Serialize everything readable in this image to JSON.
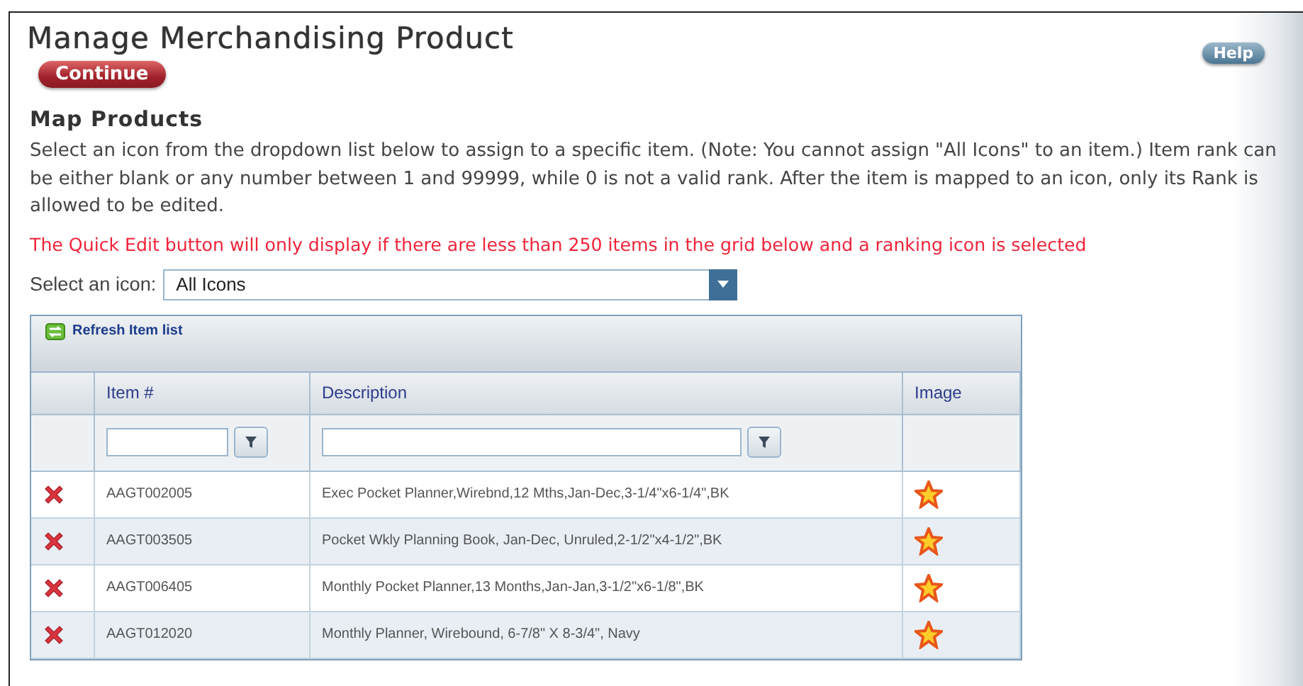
{
  "page": {
    "title": "Manage Merchandising Product"
  },
  "buttons": {
    "continue": "Continue",
    "help": "Help"
  },
  "section": {
    "heading": "Map Products",
    "instructions": "Select an icon from the dropdown list below to assign to a specific item. (Note: You cannot assign \"All Icons\" to an item.) Item rank can be either blank or any number between 1 and 99999, while 0 is not a valid rank. After the item is mapped to an icon, only its Rank is allowed to be edited.",
    "warning": "The Quick Edit button will only display if there are less than 250 items in the grid below and a ranking icon is selected"
  },
  "icon_select": {
    "label": "Select an icon:",
    "value": "All Icons"
  },
  "grid": {
    "toolbar": {
      "refresh": "Refresh Item list"
    },
    "columns": [
      "Item #",
      "Description",
      "Image"
    ],
    "rows": [
      {
        "item": "AAGT002005",
        "description": "Exec Pocket Planner,Wirebnd,12 Mths,Jan-Dec,3-1/4\"x6-1/4\",BK"
      },
      {
        "item": "AAGT003505",
        "description": "Pocket Wkly Planning Book, Jan-Dec, Unruled,2-1/2\"x4-1/2\",BK"
      },
      {
        "item": "AAGT006405",
        "description": "Monthly Pocket Planner,13 Months,Jan-Jan,3-1/2\"x6-1/8\",BK"
      },
      {
        "item": "AAGT012020",
        "description": "Monthly Planner, Wirebound, 6-7/8\" X 8-3/4\", Navy"
      }
    ]
  }
}
